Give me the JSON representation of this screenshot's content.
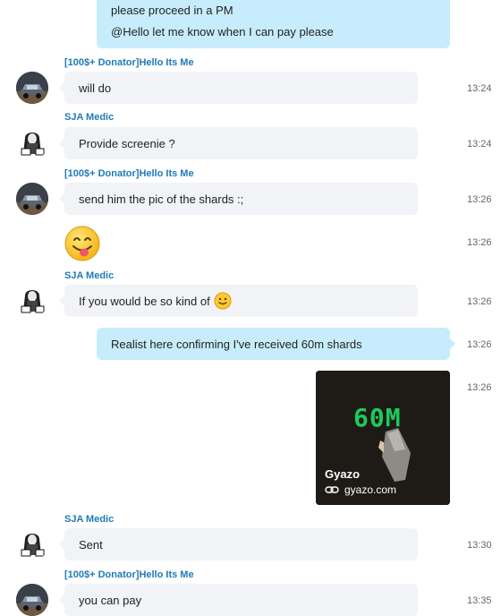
{
  "chat": {
    "messages": [
      {
        "kind": "outgoing",
        "lines": [
          "please proceed in a PM",
          "@Hello let me know when I can pay please"
        ]
      },
      {
        "kind": "incoming",
        "sender": "[100$+ Donator]Hello Its Me",
        "text": "will do",
        "time": "13:24",
        "avatar": "car-avatar"
      },
      {
        "kind": "incoming",
        "sender": "SJA Medic",
        "text": "Provide screenie ?",
        "time": "13:24",
        "avatar": "medic-avatar"
      },
      {
        "kind": "incoming",
        "sender": "[100$+ Donator]Hello Its Me",
        "text": "send him the pic of the shards :;",
        "time": "13:26",
        "avatar": "car-avatar"
      },
      {
        "kind": "emoji",
        "emoji": "tongue-smile-emoji",
        "time": "13:26"
      },
      {
        "kind": "incoming",
        "sender": "SJA Medic",
        "text": "If you would be so kind of",
        "time": "13:26",
        "avatar": "medic-avatar",
        "trailing_emoji": "slight-smile-emoji"
      },
      {
        "kind": "outgoing",
        "text": "Realist here confirming I've received 60m shards",
        "time": "13:26"
      },
      {
        "kind": "link_preview",
        "image_text": "60M",
        "title": "Gyazo",
        "domain": "gyazo.com",
        "time": "13:26",
        "icon": "link-icon"
      },
      {
        "kind": "incoming",
        "sender": "SJA Medic",
        "text": "Sent",
        "time": "13:30",
        "avatar": "medic-avatar"
      },
      {
        "kind": "incoming",
        "sender": "[100$+ Donator]Hello Its Me",
        "text": "you can pay",
        "time": "13:35",
        "avatar": "car-avatar"
      }
    ]
  },
  "colors": {
    "outgoing_bubble": "#c7edfc",
    "incoming_bubble": "#f1f3f6",
    "sender_name": "#1f7ab8",
    "timestamp": "#666666"
  }
}
